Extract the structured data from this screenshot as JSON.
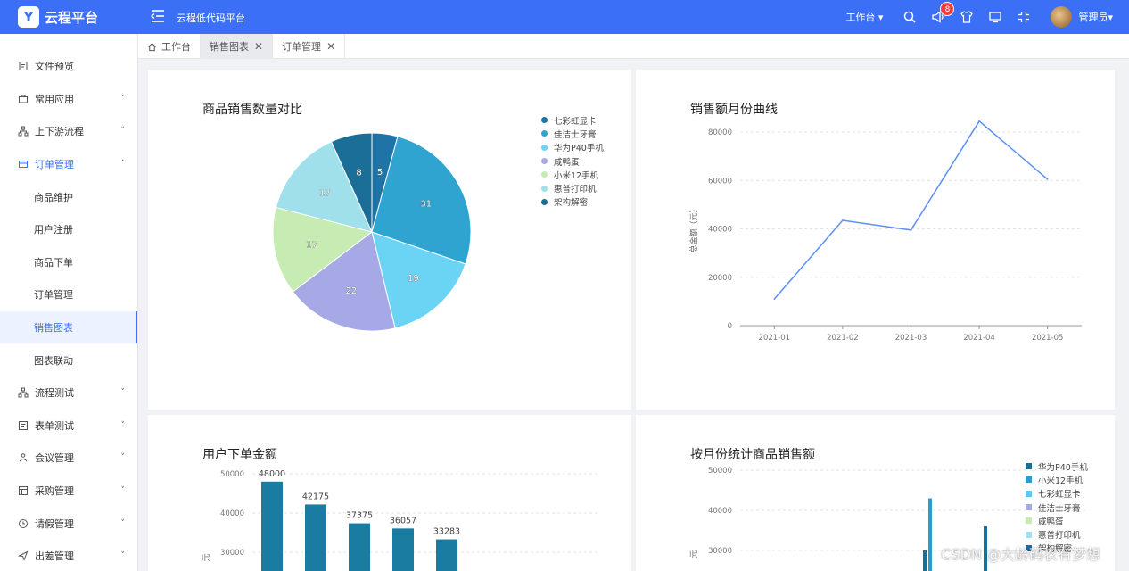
{
  "header": {
    "brand": "云程平台",
    "brand_mark": "Y",
    "system_title": "云程低代码平台",
    "workspace": "工作台 ▾",
    "notice_count": "8",
    "user": "管理员▾",
    "bg": "#3b6ff5"
  },
  "sidebar": {
    "items": [
      {
        "label": "文件预览",
        "icon": "file-preview-icon",
        "type": "item"
      },
      {
        "label": "常用应用",
        "icon": "briefcase-icon",
        "type": "group",
        "arrow": "˅"
      },
      {
        "label": "上下游流程",
        "icon": "flow-icon",
        "type": "group",
        "arrow": "˅"
      },
      {
        "label": "订单管理",
        "icon": "order-icon",
        "type": "group-open",
        "arrow": "˄"
      },
      {
        "label": "商品维护",
        "type": "sub"
      },
      {
        "label": "用户注册",
        "type": "sub"
      },
      {
        "label": "商品下单",
        "type": "sub"
      },
      {
        "label": "订单管理",
        "type": "sub"
      },
      {
        "label": "销售图表",
        "type": "sub-active"
      },
      {
        "label": "图表联动",
        "type": "sub"
      },
      {
        "label": "流程测试",
        "icon": "flow-icon",
        "type": "group",
        "arrow": "˅"
      },
      {
        "label": "表单测试",
        "icon": "form-icon",
        "type": "group",
        "arrow": "˅"
      },
      {
        "label": "会议管理",
        "icon": "meeting-icon",
        "type": "group",
        "arrow": "˅"
      },
      {
        "label": "采购管理",
        "icon": "purchase-icon",
        "type": "group",
        "arrow": "˅"
      },
      {
        "label": "请假管理",
        "icon": "leave-icon",
        "type": "group",
        "arrow": "˅"
      },
      {
        "label": "出差管理",
        "icon": "trip-icon",
        "type": "group",
        "arrow": "˅"
      }
    ]
  },
  "tabs": [
    {
      "label": "工作台",
      "home": true,
      "closable": false
    },
    {
      "label": "销售图表",
      "active": true,
      "closable": true
    },
    {
      "label": "订单管理",
      "closable": true
    }
  ],
  "close_glyph": "✕",
  "watermark": "CSDN @大龄码农有梦想",
  "chart_data": [
    {
      "type": "pie",
      "title": "商品销售数量对比",
      "series": [
        {
          "name": "七彩虹显卡",
          "value": 5,
          "color": "#1e74a6"
        },
        {
          "name": "佳洁士牙膏",
          "value": 31,
          "color": "#2fa4d0"
        },
        {
          "name": "华为P40手机",
          "value": 19,
          "color": "#6bd4f5"
        },
        {
          "name": "咸鸭蛋",
          "value": 22,
          "color": "#a6a9e6"
        },
        {
          "name": "小米12手机",
          "value": 17,
          "color": "#c6ebb3"
        },
        {
          "name": "惠普打印机",
          "value": 17,
          "color": "#9fe0ea"
        },
        {
          "name": "架构解密",
          "value": 8,
          "color": "#1a6e97"
        }
      ]
    },
    {
      "type": "line",
      "title": "销售额月份曲线",
      "ylabel": "总金额（元）",
      "categories": [
        "2021-01",
        "2021-02",
        "2021-03",
        "2021-04",
        "2021-05"
      ],
      "values": [
        11000,
        43500,
        39500,
        84500,
        60500
      ],
      "ylim": [
        0,
        80000
      ],
      "yticks": [
        0,
        20000,
        40000,
        60000,
        80000
      ],
      "color": "#5b8ff9",
      "grid": true
    },
    {
      "type": "bar",
      "title": "用户下单金额",
      "ylabel": "元",
      "values": [
        48000,
        42175,
        37375,
        36057,
        33283
      ],
      "labels": [
        "48000",
        "42175",
        "37375",
        "36057",
        "33283"
      ],
      "yticks": [
        30000,
        40000,
        50000
      ],
      "color": "#1b7ca1",
      "grid": true
    },
    {
      "type": "bar",
      "title": "按月份统计商品销售额",
      "ylabel": "元",
      "yticks": [
        30000,
        40000,
        50000
      ],
      "grid": true,
      "legend_position": "top-right",
      "series": [
        {
          "name": "华为P40手机",
          "color": "#1b6f97"
        },
        {
          "name": "小米12手机",
          "color": "#2b9ccc"
        },
        {
          "name": "七彩虹显卡",
          "color": "#5fc6ef"
        },
        {
          "name": "佳洁士牙膏",
          "color": "#a6a9e6"
        },
        {
          "name": "咸鸭蛋",
          "color": "#c6ebb3"
        },
        {
          "name": "惠普打印机",
          "color": "#9fe0ea"
        },
        {
          "name": "架构解密",
          "color": "#1a6e97"
        }
      ],
      "visible_bars": [
        {
          "series": "小米12手机",
          "value": 43000
        },
        {
          "series": "华为P40手机",
          "value": 36000
        },
        {
          "series": "华为P40手机",
          "value": 30000
        }
      ]
    }
  ]
}
